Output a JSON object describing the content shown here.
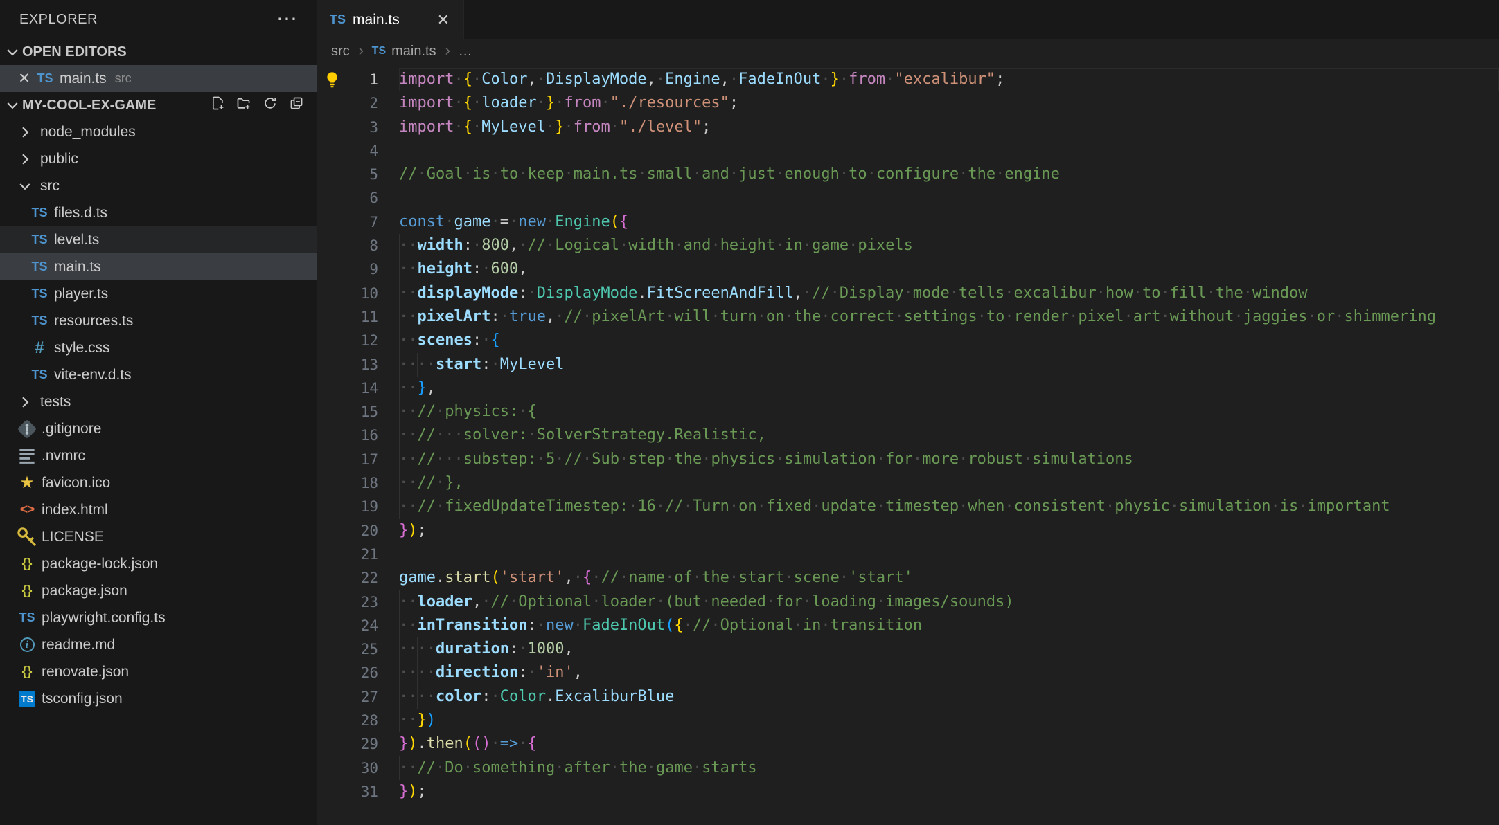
{
  "palette": {
    "editor_bg": "#1F1F1F",
    "sidebar_bg": "#181818",
    "selected_row_bg": "#3A3D41",
    "accent_blue": "#007ACC",
    "ts_icon_blue": "#4E94CE",
    "keyword_pink": "#C586C0",
    "keyword_blue": "#569CD6",
    "class_teal": "#4EC9B0",
    "string_orange": "#CE9178",
    "number_green": "#B5CEA8",
    "comment_green": "#6A9955",
    "bracket_gold": "#FFD700",
    "bracket_pink": "#DA70D6",
    "bracket_blue": "#179FFF",
    "lightbulb_yellow": "#FFCC00"
  },
  "explorer": {
    "title": "EXPLORER",
    "more_label": "⋯",
    "open_editors": {
      "label": "OPEN EDITORS",
      "items": [
        {
          "close": "✕",
          "icon": "ts",
          "name": "main.ts",
          "detail": "src",
          "active": true
        }
      ]
    },
    "workspace": {
      "label": "MY-COOL-EX-GAME",
      "actions": [
        "new-file",
        "new-folder",
        "refresh",
        "collapse-all"
      ]
    },
    "tree": [
      {
        "label": "node_modules",
        "type": "folder",
        "state": "collapsed",
        "level": 0
      },
      {
        "label": "public",
        "type": "folder",
        "state": "collapsed",
        "level": 0
      },
      {
        "label": "src",
        "type": "folder",
        "state": "expanded",
        "level": 0
      },
      {
        "label": "files.d.ts",
        "icon": "ts",
        "level": 1,
        "guide": true
      },
      {
        "label": "level.ts",
        "icon": "ts",
        "level": 1,
        "guide": true,
        "hover": true
      },
      {
        "label": "main.ts",
        "icon": "ts",
        "level": 1,
        "guide": true,
        "selected": true
      },
      {
        "label": "player.ts",
        "icon": "ts",
        "level": 1,
        "guide": true
      },
      {
        "label": "resources.ts",
        "icon": "ts",
        "level": 1,
        "guide": true
      },
      {
        "label": "style.css",
        "icon": "css",
        "level": 1,
        "guide": true
      },
      {
        "label": "vite-env.d.ts",
        "icon": "ts",
        "level": 1,
        "guide": true
      },
      {
        "label": "tests",
        "type": "folder",
        "state": "collapsed",
        "level": 0
      },
      {
        "label": ".gitignore",
        "icon": "git",
        "level": 0
      },
      {
        "label": ".nvmrc",
        "icon": "config",
        "level": 0
      },
      {
        "label": "favicon.ico",
        "icon": "star",
        "level": 0
      },
      {
        "label": "index.html",
        "icon": "html",
        "level": 0
      },
      {
        "label": "LICENSE",
        "icon": "key",
        "level": 0
      },
      {
        "label": "package-lock.json",
        "icon": "json",
        "level": 0
      },
      {
        "label": "package.json",
        "icon": "json",
        "level": 0
      },
      {
        "label": "playwright.config.ts",
        "icon": "ts",
        "level": 0
      },
      {
        "label": "readme.md",
        "icon": "info",
        "level": 0
      },
      {
        "label": "renovate.json",
        "icon": "json",
        "level": 0
      },
      {
        "label": "tsconfig.json",
        "icon": "tsconfig",
        "level": 0
      }
    ]
  },
  "editor": {
    "tab": {
      "icon": "ts",
      "label": "main.ts",
      "close": "✕"
    },
    "breadcrumb": [
      {
        "label": "src"
      },
      {
        "label": "main.ts",
        "icon": "ts"
      },
      {
        "label": "…"
      }
    ],
    "current_line": 1,
    "lines": [
      {
        "n": 1,
        "tokens": [
          [
            "kw1",
            "import"
          ],
          [
            "pun",
            " "
          ],
          [
            "b1",
            "{"
          ],
          [
            "pun",
            " "
          ],
          [
            "var",
            "Color"
          ],
          [
            "pun",
            ", "
          ],
          [
            "var",
            "DisplayMode"
          ],
          [
            "pun",
            ", "
          ],
          [
            "var",
            "Engine"
          ],
          [
            "pun",
            ", "
          ],
          [
            "var",
            "FadeInOut"
          ],
          [
            "pun",
            " "
          ],
          [
            "b1",
            "}"
          ],
          [
            "pun",
            " "
          ],
          [
            "kw1",
            "from"
          ],
          [
            "pun",
            " "
          ],
          [
            "str",
            "\"excalibur\""
          ],
          [
            "pun",
            ";"
          ]
        ]
      },
      {
        "n": 2,
        "tokens": [
          [
            "kw1",
            "import"
          ],
          [
            "pun",
            " "
          ],
          [
            "b1",
            "{"
          ],
          [
            "pun",
            " "
          ],
          [
            "var",
            "loader"
          ],
          [
            "pun",
            " "
          ],
          [
            "b1",
            "}"
          ],
          [
            "pun",
            " "
          ],
          [
            "kw1",
            "from"
          ],
          [
            "pun",
            " "
          ],
          [
            "str",
            "\"./resources\""
          ],
          [
            "pun",
            ";"
          ]
        ]
      },
      {
        "n": 3,
        "tokens": [
          [
            "kw1",
            "import"
          ],
          [
            "pun",
            " "
          ],
          [
            "b1",
            "{"
          ],
          [
            "pun",
            " "
          ],
          [
            "var",
            "MyLevel"
          ],
          [
            "pun",
            " "
          ],
          [
            "b1",
            "}"
          ],
          [
            "pun",
            " "
          ],
          [
            "kw1",
            "from"
          ],
          [
            "pun",
            " "
          ],
          [
            "str",
            "\"./level\""
          ],
          [
            "pun",
            ";"
          ]
        ]
      },
      {
        "n": 4,
        "tokens": []
      },
      {
        "n": 5,
        "tokens": [
          [
            "com",
            "// Goal is to keep main.ts small and just enough to configure the engine"
          ]
        ]
      },
      {
        "n": 6,
        "tokens": []
      },
      {
        "n": 7,
        "tokens": [
          [
            "kw2",
            "const"
          ],
          [
            "pun",
            " "
          ],
          [
            "var",
            "game"
          ],
          [
            "pun",
            " = "
          ],
          [
            "kw2",
            "new"
          ],
          [
            "pun",
            " "
          ],
          [
            "cls",
            "Engine"
          ],
          [
            "b1",
            "("
          ],
          [
            "b2",
            "{"
          ]
        ]
      },
      {
        "n": 8,
        "tokens": [
          [
            "ind",
            "  "
          ],
          [
            "prop",
            "width"
          ],
          [
            "pun",
            ": "
          ],
          [
            "num",
            "800"
          ],
          [
            "pun",
            ", "
          ],
          [
            "com",
            "// Logical width and height in game pixels"
          ]
        ]
      },
      {
        "n": 9,
        "tokens": [
          [
            "ind",
            "  "
          ],
          [
            "prop",
            "height"
          ],
          [
            "pun",
            ": "
          ],
          [
            "num",
            "600"
          ],
          [
            "pun",
            ","
          ]
        ]
      },
      {
        "n": 10,
        "tokens": [
          [
            "ind",
            "  "
          ],
          [
            "prop",
            "displayMode"
          ],
          [
            "pun",
            ": "
          ],
          [
            "cls",
            "DisplayMode"
          ],
          [
            "pun",
            "."
          ],
          [
            "var",
            "FitScreenAndFill"
          ],
          [
            "pun",
            ", "
          ],
          [
            "com",
            "// Display mode tells excalibur how to fill the window"
          ]
        ]
      },
      {
        "n": 11,
        "tokens": [
          [
            "ind",
            "  "
          ],
          [
            "prop",
            "pixelArt"
          ],
          [
            "pun",
            ": "
          ],
          [
            "kw2",
            "true"
          ],
          [
            "pun",
            ", "
          ],
          [
            "com",
            "// pixelArt will turn on the correct settings to render pixel art without jaggies or shimmering"
          ]
        ]
      },
      {
        "n": 12,
        "tokens": [
          [
            "ind",
            "  "
          ],
          [
            "prop",
            "scenes"
          ],
          [
            "pun",
            ": "
          ],
          [
            "b3",
            "{"
          ]
        ]
      },
      {
        "n": 13,
        "tokens": [
          [
            "ind",
            "    "
          ],
          [
            "prop",
            "start"
          ],
          [
            "pun",
            ": "
          ],
          [
            "var",
            "MyLevel"
          ]
        ]
      },
      {
        "n": 14,
        "tokens": [
          [
            "ind",
            "  "
          ],
          [
            "b3",
            "}"
          ],
          [
            "pun",
            ","
          ]
        ]
      },
      {
        "n": 15,
        "tokens": [
          [
            "ind",
            "  "
          ],
          [
            "com",
            "// physics: {"
          ]
        ]
      },
      {
        "n": 16,
        "tokens": [
          [
            "ind",
            "  "
          ],
          [
            "com",
            "//   solver: SolverStrategy.Realistic,"
          ]
        ]
      },
      {
        "n": 17,
        "tokens": [
          [
            "ind",
            "  "
          ],
          [
            "com",
            "//   substep: 5 // Sub step the physics simulation for more robust simulations"
          ]
        ]
      },
      {
        "n": 18,
        "tokens": [
          [
            "ind",
            "  "
          ],
          [
            "com",
            "// },"
          ]
        ]
      },
      {
        "n": 19,
        "tokens": [
          [
            "ind",
            "  "
          ],
          [
            "com",
            "// fixedUpdateTimestep: 16 // Turn on fixed update timestep when consistent physic simulation is important"
          ]
        ]
      },
      {
        "n": 20,
        "tokens": [
          [
            "b2",
            "}"
          ],
          [
            "b1",
            ")"
          ],
          [
            "pun",
            ";"
          ]
        ]
      },
      {
        "n": 21,
        "tokens": []
      },
      {
        "n": 22,
        "tokens": [
          [
            "var",
            "game"
          ],
          [
            "pun",
            "."
          ],
          [
            "fn",
            "start"
          ],
          [
            "b1",
            "("
          ],
          [
            "str",
            "'start'"
          ],
          [
            "pun",
            ", "
          ],
          [
            "b2",
            "{"
          ],
          [
            "pun",
            " "
          ],
          [
            "com",
            "// name of the start scene 'start'"
          ]
        ]
      },
      {
        "n": 23,
        "tokens": [
          [
            "ind",
            "  "
          ],
          [
            "prop",
            "loader"
          ],
          [
            "pun",
            ", "
          ],
          [
            "com",
            "// Optional loader (but needed for loading images/sounds)"
          ]
        ]
      },
      {
        "n": 24,
        "tokens": [
          [
            "ind",
            "  "
          ],
          [
            "prop",
            "inTransition"
          ],
          [
            "pun",
            ": "
          ],
          [
            "kw2",
            "new"
          ],
          [
            "pun",
            " "
          ],
          [
            "cls",
            "FadeInOut"
          ],
          [
            "b3",
            "("
          ],
          [
            "b1",
            "{"
          ],
          [
            "pun",
            " "
          ],
          [
            "com",
            "// Optional in transition"
          ]
        ]
      },
      {
        "n": 25,
        "tokens": [
          [
            "ind",
            "    "
          ],
          [
            "prop",
            "duration"
          ],
          [
            "pun",
            ": "
          ],
          [
            "num",
            "1000"
          ],
          [
            "pun",
            ","
          ]
        ]
      },
      {
        "n": 26,
        "tokens": [
          [
            "ind",
            "    "
          ],
          [
            "prop",
            "direction"
          ],
          [
            "pun",
            ": "
          ],
          [
            "str",
            "'in'"
          ],
          [
            "pun",
            ","
          ]
        ]
      },
      {
        "n": 27,
        "tokens": [
          [
            "ind",
            "    "
          ],
          [
            "prop",
            "color"
          ],
          [
            "pun",
            ": "
          ],
          [
            "cls",
            "Color"
          ],
          [
            "pun",
            "."
          ],
          [
            "var",
            "ExcaliburBlue"
          ]
        ]
      },
      {
        "n": 28,
        "tokens": [
          [
            "ind",
            "  "
          ],
          [
            "b1",
            "}"
          ],
          [
            "b3",
            ")"
          ]
        ]
      },
      {
        "n": 29,
        "tokens": [
          [
            "b2",
            "}"
          ],
          [
            "b1",
            ")"
          ],
          [
            "pun",
            "."
          ],
          [
            "fn",
            "then"
          ],
          [
            "b1",
            "("
          ],
          [
            "b2",
            "("
          ],
          [
            "b2",
            ")"
          ],
          [
            "pun",
            " "
          ],
          [
            "kw2",
            "=>"
          ],
          [
            "pun",
            " "
          ],
          [
            "b2",
            "{"
          ]
        ]
      },
      {
        "n": 30,
        "tokens": [
          [
            "ind",
            "  "
          ],
          [
            "com",
            "// Do something after the game starts"
          ]
        ]
      },
      {
        "n": 31,
        "tokens": [
          [
            "b2",
            "}"
          ],
          [
            "b1",
            ")"
          ],
          [
            "pun",
            ";"
          ]
        ]
      }
    ]
  }
}
